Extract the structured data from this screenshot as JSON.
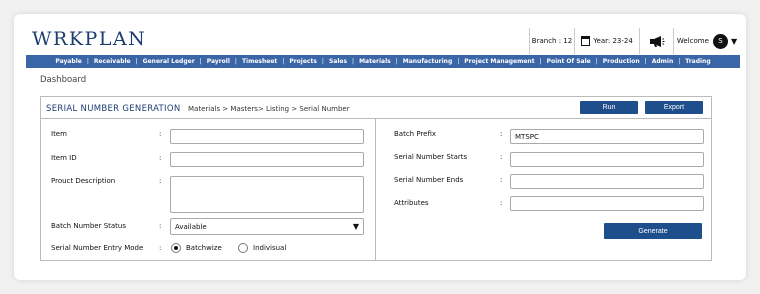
{
  "app": {
    "logo": "WRKPLAN"
  },
  "header": {
    "branch": "Branch : 12",
    "year": "Year: 23-24",
    "welcome": "Welcome",
    "avatar_initial": "S"
  },
  "nav": [
    "Payable",
    "Receivable",
    "General Ledger",
    "Payroll",
    "Timesheet",
    "Projects",
    "Sales",
    "Materials",
    "Manufacturing",
    "Project Management",
    "Point Of Sale",
    "Production",
    "Admin",
    "Trading"
  ],
  "page": {
    "dashboard": "Dashboard"
  },
  "panel": {
    "title": "SERIAL NUMBER GENERATION",
    "breadcrumb": "Materials > Masters> Listing > Serial Number",
    "run_label": "Run",
    "export_label": "Export"
  },
  "form": {
    "item_label": "Item",
    "item_id_label": "Item ID",
    "description_label": "Prouct Description",
    "batch_status_label": "Batch Number Status",
    "batch_status_value": "Available",
    "entry_mode_label": "Serial Number Entry Mode",
    "mode_batchwise": "Batchwize",
    "mode_individual": "Indivisual",
    "batch_prefix_label": "Batch Prefix",
    "batch_prefix_value": "MTSPC",
    "serial_starts_label": "Serial Number Starts",
    "serial_ends_label": "Serial Number Ends",
    "attributes_label": "Attributes",
    "generate_label": "Generate",
    "colon": ":"
  }
}
